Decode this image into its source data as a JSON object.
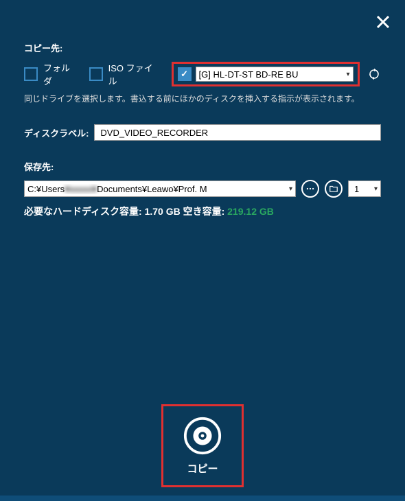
{
  "copyDest": {
    "label": "コピー先:",
    "folder": {
      "label": "フォルダ",
      "checked": false
    },
    "iso": {
      "label": "ISO ファイル",
      "checked": false
    },
    "drive": {
      "checked": true,
      "selected": "[G] HL-DT-ST BD-RE BU"
    }
  },
  "hint": "同じドライブを選択します。書込する前にほかのディスクを挿入する指示が表示されます。",
  "discLabel": {
    "label": "ディスクラベル:",
    "value": "DVD_VIDEO_RECORDER"
  },
  "saveDest": {
    "label": "保存先:",
    "pathPrefix": "C:¥Users",
    "pathBlur": "¥xxxxx¥",
    "pathSuffix": "Documents¥Leawo¥Prof. M",
    "copies": "1"
  },
  "diskInfo": {
    "reqLabel": "必要なハードディスク容量:",
    "reqValue": "1.70 GB",
    "freeLabel": "空き容量:",
    "freeValue": "219.12 GB"
  },
  "copyButton": {
    "label": "コピー"
  }
}
